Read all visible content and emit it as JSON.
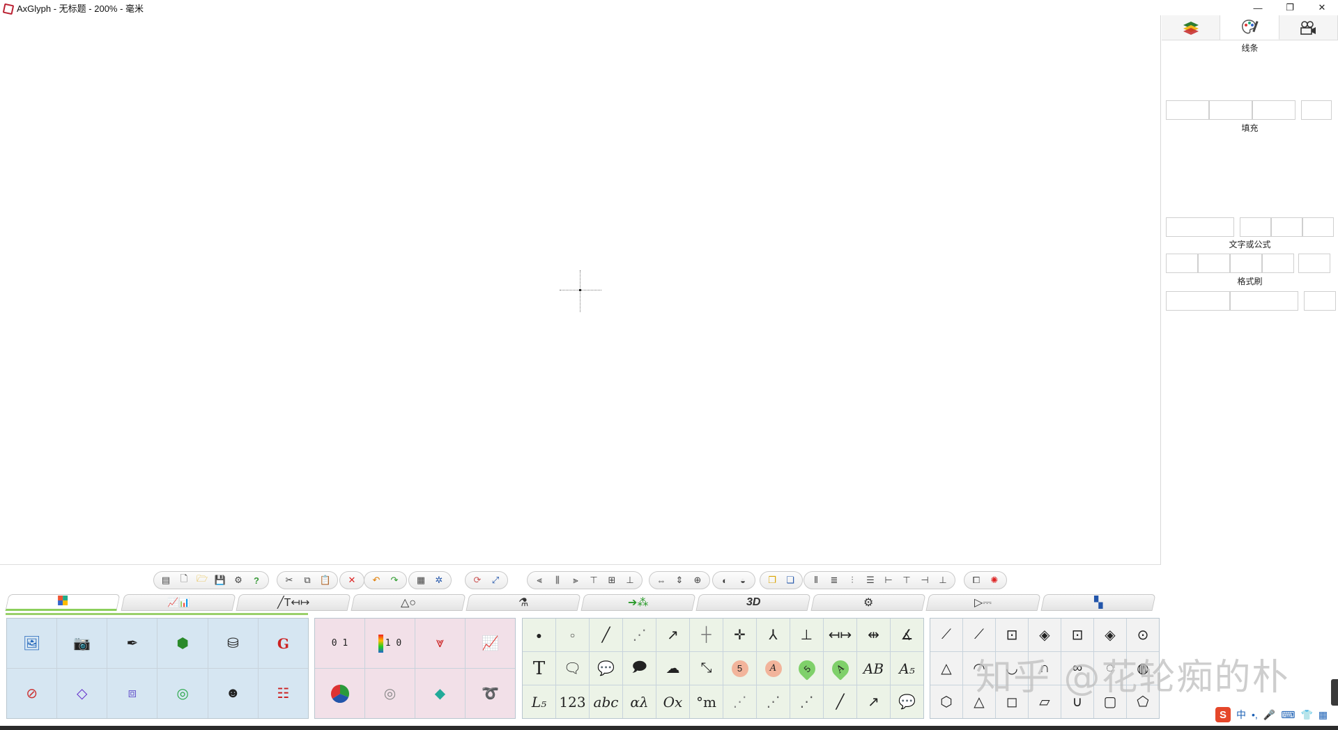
{
  "window": {
    "title": "AxGlyph - 无标题 - 200% - 毫米",
    "controls": [
      "—",
      "❐",
      "✕"
    ]
  },
  "right_panel": {
    "tabs": [
      "layers-icon",
      "palette-icon",
      "camera-icon"
    ],
    "sections": {
      "line": "线条",
      "fill": "填充",
      "text": "文字或公式",
      "format": "格式刷"
    }
  },
  "category_tabs": [
    {
      "name": "picture-tools",
      "label": "▦"
    },
    {
      "name": "chart-tools",
      "label": "📈📊"
    },
    {
      "name": "line-text-tools",
      "label": "╱T↤↦"
    },
    {
      "name": "shape-tools",
      "label": "△○"
    },
    {
      "name": "lab-tools",
      "label": "⚗"
    },
    {
      "name": "flow-tools",
      "label": "➔⁂"
    },
    {
      "name": "3d-tools",
      "label": "3D"
    },
    {
      "name": "mech-tools",
      "label": "⚙"
    },
    {
      "name": "circuit-tools",
      "label": "▷⎓"
    },
    {
      "name": "more-tools",
      "label": "▚"
    }
  ],
  "palette_text": {
    "text_T": "T",
    "subscript_L": "L₅",
    "numbers": "123",
    "abc": "abc",
    "greek": "αλ",
    "ox": "Ox",
    "degree_m": "°m",
    "ab": "AB",
    "a5": "A₅",
    "circle5": "5",
    "circleA": "A",
    "ruler_label": "0 1",
    "colorbar_label": "1 0"
  },
  "watermark": "知乎 @花轮痴的朴",
  "tray": {
    "ime": "S",
    "lang": "中"
  }
}
